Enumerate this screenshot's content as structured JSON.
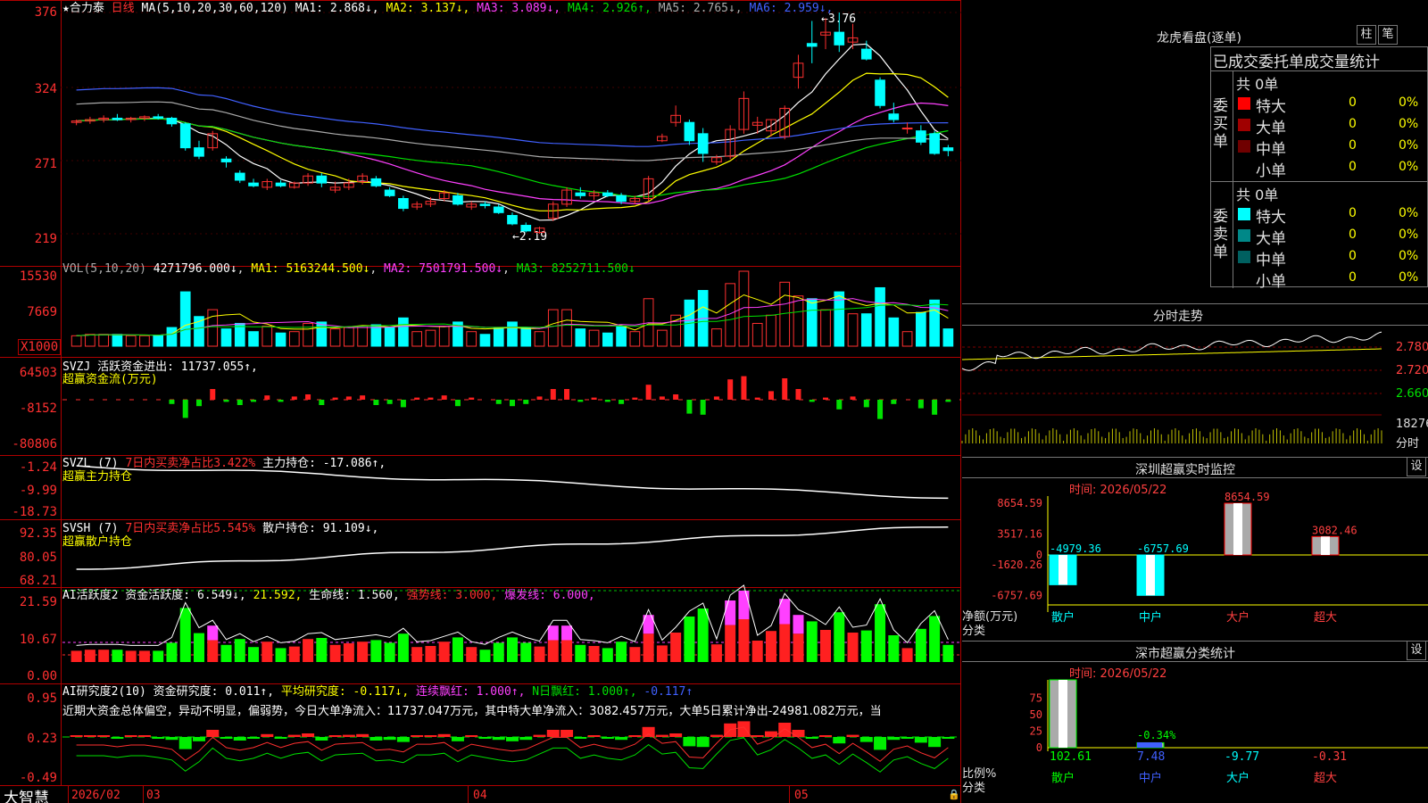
{
  "stock": {
    "name": "合力泰",
    "period": "日线",
    "ma_legend": "MA(5,10,20,30,60,120)",
    "ma_values": [
      {
        "label": "MA1: 2.868",
        "arrow": "↓",
        "color": "#ffffff"
      },
      {
        "label": "MA2: 3.137",
        "arrow": "↓",
        "color": "#ffff00"
      },
      {
        "label": "MA3: 3.089",
        "arrow": "↓",
        "color": "#ff40ff"
      },
      {
        "label": "MA4: 2.926",
        "arrow": "↑",
        "color": "#00e000"
      },
      {
        "label": "MA5: 2.765",
        "arrow": "↓",
        "color": "#aaaaaa"
      },
      {
        "label": "MA6: 2.959",
        "arrow": "↓",
        "color": "#4060ff"
      }
    ],
    "high_mark": "3.76",
    "low_mark": "2.19"
  },
  "main_axis": [
    "376",
    "324",
    "271",
    "219"
  ],
  "vol_panel": {
    "title": "VOL(5,10,20)",
    "value": "4271796.000↓",
    "ma1": "MA1: 5163244.500↓",
    "ma2": "MA2: 7501791.500↓",
    "ma3": "MA3: 8252711.500↓",
    "axis": [
      "15530",
      "7669"
    ],
    "unit": "X1000"
  },
  "svzj_panel": {
    "title": "SVZJ  活跃资金进出: 11737.055↑,",
    "subtitle": "超赢资金流(万元)",
    "axis": [
      "64503",
      "-8152",
      "-80806"
    ]
  },
  "svzl_panel": {
    "title": "SVZL (7)",
    "highlight": "7日内买卖净占比3.422%",
    "main_hold": "主力持仓: -17.086↑,",
    "subtitle": "超赢主力持仓",
    "axis": [
      "-1.24",
      "-9.99",
      "-18.73"
    ]
  },
  "svsh_panel": {
    "title": "SVSH (7)",
    "highlight": "7日内买卖净占比5.545%",
    "retail_hold": "散户持仓: 91.109↓,",
    "subtitle": "超赢散户持仓",
    "axis": [
      "92.35",
      "80.05",
      "68.21"
    ]
  },
  "ai_active_panel": {
    "title": "AI活跃度2 资金活跃度: 6.549↓,",
    "v2": "21.592,",
    "life": "生命线: 1.560,",
    "strong": "强势线: 3.000,",
    "burst": "爆发线: 6.000,",
    "axis": [
      "21.59",
      "10.67",
      "0.00"
    ]
  },
  "ai_research_panel": {
    "title": "AI研究度2(10) 资金研究度: 0.011↑,",
    "avg": "平均研究度: -0.117↓,",
    "streak": "连续飘红: 1.000↑,",
    "nday": "N日飘红: 1.000↑,",
    "last": "-0.117↑",
    "comment": "近期大资金总体偏空，异动不明显，偏弱势，今日大单净流入：11737.047万元，其中特大单净流入：3082.457万元，大单5日累计净出-24981.082万元，当",
    "axis": [
      "0.95",
      "0.23",
      "-0.49"
    ]
  },
  "bottom_bar": {
    "brand": "大智慧",
    "date": "2026/02",
    "months": [
      "03",
      "04",
      "05"
    ]
  },
  "right_panel": {
    "lhb_title": "龙虎看盘(逐单)",
    "btn_zhu": "柱",
    "btn_bi": "笔",
    "tabs_title": "已成交委托单成交量统计",
    "buy_label": "委买单",
    "sell_label": "委卖单",
    "buy_total": "共 0单",
    "sell_total": "共 0单",
    "buy_rows": [
      {
        "name": "特大",
        "value": "0",
        "pct": "0%",
        "color": "#ff0000"
      },
      {
        "name": "大单",
        "value": "0",
        "pct": "0%",
        "color": "#a00000"
      },
      {
        "name": "中单",
        "value": "0",
        "pct": "0%",
        "color": "#700000"
      },
      {
        "name": "小单",
        "value": "0",
        "pct": "0%",
        "color": "#000000"
      }
    ],
    "sell_rows": [
      {
        "name": "特大",
        "value": "0",
        "pct": "0%",
        "color": "#00ffff"
      },
      {
        "name": "大单",
        "value": "0",
        "pct": "0%",
        "color": "#008888"
      },
      {
        "name": "中单",
        "value": "0",
        "pct": "0%",
        "color": "#006060"
      },
      {
        "name": "小单",
        "value": "0",
        "pct": "0%",
        "color": "#000000"
      }
    ],
    "intraday_title": "分时走势",
    "intraday_axis": [
      "2.780",
      "2.720",
      "2.660",
      "18276"
    ],
    "intraday_unit": "分时",
    "sz_monitor": {
      "title": "深圳超赢实时监控",
      "settings": "设",
      "time": "时间: 2026/05/22",
      "axis": [
        "8654.59",
        "3517.16",
        "0",
        "-1620.26",
        "-6757.69"
      ],
      "y_caption": "净额(万元)",
      "x_caption": "分类",
      "bars": [
        {
          "label": "散户",
          "value": "-4979.36",
          "num": -4979.36
        },
        {
          "label": "中户",
          "value": "-6757.69",
          "num": -6757.69
        },
        {
          "label": "大户",
          "value": "8654.59",
          "num": 8654.59
        },
        {
          "label": "超大",
          "value": "3082.46",
          "num": 3082.46
        }
      ]
    },
    "sz_class": {
      "title": "深市超赢分类统计",
      "settings": "设",
      "time": "时间: 2026/05/22",
      "axis": [
        "75",
        "50",
        "25",
        "0"
      ],
      "y_caption": "比例%",
      "x_caption": "分类",
      "bars": [
        {
          "label": "散户",
          "value": "102.61",
          "num": 102.61
        },
        {
          "label": "中户",
          "value": "7.48",
          "num": 7.48
        },
        {
          "label": "大户",
          "value": "-9.77",
          "num": -9.77
        },
        {
          "label": "超大",
          "value": "-0.31",
          "num": -0.31
        }
      ],
      "note": "-0.34%"
    }
  },
  "chart_data": {
    "type": "candlestick",
    "title": "合力泰 日线",
    "ylim": [
      2.19,
      3.76
    ],
    "candles": [
      [
        2.98,
        3.0,
        2.96,
        2.99
      ],
      [
        2.99,
        3.02,
        2.97,
        3.0
      ],
      [
        3.0,
        3.03,
        2.98,
        3.01
      ],
      [
        3.01,
        3.04,
        2.99,
        3.0
      ],
      [
        3.0,
        3.02,
        2.98,
        3.01
      ],
      [
        3.01,
        3.03,
        2.99,
        3.02
      ],
      [
        3.02,
        3.04,
        3.0,
        3.01
      ],
      [
        3.01,
        3.02,
        2.95,
        2.97
      ],
      [
        2.97,
        2.98,
        2.78,
        2.8
      ],
      [
        2.8,
        2.85,
        2.72,
        2.74
      ],
      [
        2.8,
        2.92,
        2.78,
        2.9
      ],
      [
        2.72,
        2.74,
        2.66,
        2.7
      ],
      [
        2.62,
        2.64,
        2.55,
        2.57
      ],
      [
        2.55,
        2.58,
        2.52,
        2.53
      ],
      [
        2.52,
        2.58,
        2.5,
        2.56
      ],
      [
        2.55,
        2.57,
        2.52,
        2.53
      ],
      [
        2.52,
        2.56,
        2.51,
        2.55
      ],
      [
        2.55,
        2.62,
        2.53,
        2.6
      ],
      [
        2.6,
        2.62,
        2.52,
        2.55
      ],
      [
        2.5,
        2.56,
        2.48,
        2.52
      ],
      [
        2.52,
        2.58,
        2.5,
        2.55
      ],
      [
        2.56,
        2.62,
        2.54,
        2.6
      ],
      [
        2.58,
        2.6,
        2.52,
        2.53
      ],
      [
        2.5,
        2.52,
        2.45,
        2.46
      ],
      [
        2.44,
        2.46,
        2.35,
        2.37
      ],
      [
        2.38,
        2.42,
        2.36,
        2.4
      ],
      [
        2.4,
        2.45,
        2.38,
        2.42
      ],
      [
        2.44,
        2.5,
        2.42,
        2.48
      ],
      [
        2.46,
        2.48,
        2.39,
        2.4
      ],
      [
        2.38,
        2.42,
        2.36,
        2.4
      ],
      [
        2.4,
        2.42,
        2.37,
        2.39
      ],
      [
        2.38,
        2.4,
        2.33,
        2.34
      ],
      [
        2.32,
        2.34,
        2.25,
        2.26
      ],
      [
        2.25,
        2.27,
        2.2,
        2.21
      ],
      [
        2.2,
        2.24,
        2.19,
        2.23
      ],
      [
        2.3,
        2.42,
        2.28,
        2.4
      ],
      [
        2.4,
        2.52,
        2.38,
        2.5
      ],
      [
        2.48,
        2.52,
        2.44,
        2.46
      ],
      [
        2.46,
        2.5,
        2.43,
        2.48
      ],
      [
        2.48,
        2.5,
        2.45,
        2.46
      ],
      [
        2.46,
        2.48,
        2.4,
        2.42
      ],
      [
        2.42,
        2.46,
        2.4,
        2.44
      ],
      [
        2.44,
        2.6,
        2.42,
        2.58
      ],
      [
        2.85,
        2.9,
        2.84,
        2.88
      ],
      [
        2.98,
        3.1,
        2.95,
        3.03
      ],
      [
        2.98,
        3.0,
        2.82,
        2.85
      ],
      [
        2.9,
        2.94,
        2.7,
        2.76
      ],
      [
        2.7,
        2.75,
        2.68,
        2.73
      ],
      [
        2.74,
        2.96,
        2.72,
        2.93
      ],
      [
        2.93,
        3.2,
        2.9,
        3.15
      ],
      [
        2.96,
        3.02,
        2.9,
        2.98
      ],
      [
        2.92,
        3.0,
        2.88,
        3.0
      ],
      [
        2.88,
        3.1,
        2.86,
        3.08
      ],
      [
        3.3,
        3.46,
        3.22,
        3.4
      ],
      [
        3.54,
        3.7,
        3.4,
        3.52
      ],
      [
        3.6,
        3.72,
        3.5,
        3.62
      ],
      [
        3.62,
        3.76,
        3.48,
        3.53
      ],
      [
        3.55,
        3.68,
        3.5,
        3.58
      ],
      [
        3.5,
        3.56,
        3.42,
        3.43
      ],
      [
        3.28,
        3.3,
        3.08,
        3.1
      ],
      [
        3.04,
        3.12,
        2.98,
        3.0
      ],
      [
        2.94,
        2.98,
        2.9,
        2.94
      ],
      [
        2.92,
        2.96,
        2.82,
        2.84
      ],
      [
        2.9,
        2.92,
        2.75,
        2.76
      ],
      [
        2.8,
        2.82,
        2.74,
        2.78
      ]
    ]
  }
}
